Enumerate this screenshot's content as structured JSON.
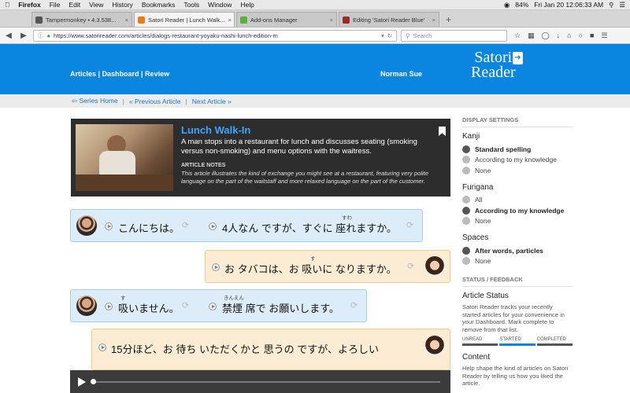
{
  "menubar": {
    "items": [
      "Firefox",
      "File",
      "Edit",
      "View",
      "History",
      "Bookmarks",
      "Tools",
      "Window",
      "Help"
    ],
    "battery": "84%",
    "clock": "Fri Jan 20  12:06:33 AM"
  },
  "tabs": [
    {
      "title": "Tampermonkey • 4.3.538...",
      "active": false,
      "color": "#555555"
    },
    {
      "title": "Satori Reader | Lunch Walk...",
      "active": true,
      "color": "#f07a1a"
    },
    {
      "title": "Add-ons Manager",
      "active": false,
      "color": "#5ab03a"
    },
    {
      "title": "Editing 'Satori Reader Blue'",
      "active": false,
      "color": "#9a2b2b"
    }
  ],
  "navbar": {
    "url": "https://www.satorireader.com/articles/dialogs-restaurant-yoyaku-nashi-lunch-edition-m",
    "search_placeholder": "Search"
  },
  "header": {
    "nav_links": "Articles | Dashboard | Review",
    "user": "Norman Sue",
    "logo_line1": "Satori",
    "logo_line2": "Reader"
  },
  "subnav": {
    "series_home": "⇦ Series Home",
    "previous": "« Previous Article",
    "next": "Next Article »"
  },
  "article": {
    "title": "Lunch Walk-In",
    "description": "A man stops into a restaurant for lunch and discusses seating (smoking versus non-smoking) and menu options with the waitress.",
    "notes_title": "ARTICLE NOTES",
    "notes": "This article illustrates the kind of exchange you might see at a restaurant, featuring very polite language on the part of the waitstaff and more relaxed language on the part of the customer."
  },
  "dialog": {
    "l1a": "こんにちは。",
    "l1b": "4人なん ですが、すぐに 座れますか。",
    "l1b_ruby": "すわ",
    "l2": "お タバコは、お 吸いに なりますか。",
    "l2_ruby": "す",
    "l3a": "吸いません。",
    "l3a_ruby": "す",
    "l3b": "禁煙 席で お願いします。",
    "l3b_ruby": "きんえん",
    "l4": "15分ほど、お 待ち いただくかと 思うの ですが、よろしい"
  },
  "sidebar": {
    "display_settings": "DISPLAY SETTINGS",
    "kanji_title": "Kanji",
    "kanji_options": [
      "Standard spelling",
      "According to my knowledge",
      "None"
    ],
    "furigana_title": "Furigana",
    "furigana_options": [
      "All",
      "According to my knowledge",
      "None"
    ],
    "spaces_title": "Spaces",
    "spaces_options": [
      "After words, particles",
      "None"
    ],
    "status_feedback": "STATUS / FEEDBACK",
    "article_status_title": "Article Status",
    "article_status_text": "Satori Reader tracks your recently started articles for your convenience in your Dashboard. Mark complete to remove from that list.",
    "status_labels": [
      "UNREAD",
      "STARTED",
      "COMPLETED"
    ],
    "content_title": "Content",
    "content_text": "Help shape the kind of articles on Satori Reader by telling us how you liked the article."
  }
}
